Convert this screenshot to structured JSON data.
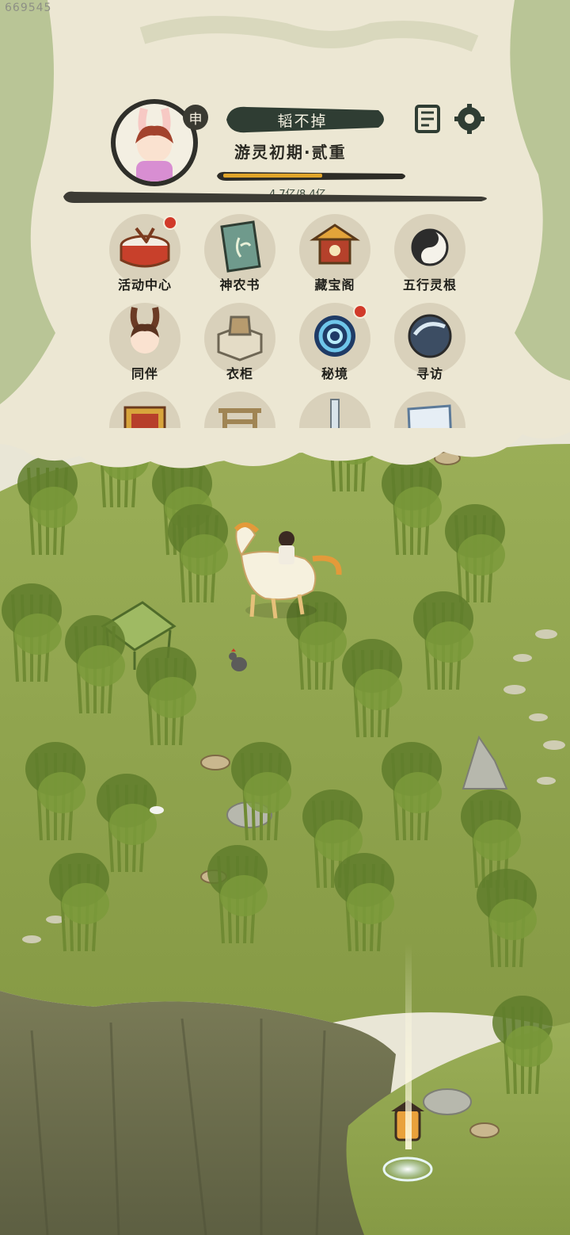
{
  "watermark": "669545",
  "player": {
    "name": "韬不掉",
    "zodiac_badge": "申",
    "realm": "游灵初期·贰重",
    "xp_text": "4.7亿/8.4亿",
    "xp_progress": 0.56
  },
  "top_icons": [
    "scroll-book-icon",
    "gear-icon"
  ],
  "menu": [
    {
      "label": "活动中心",
      "icon": "drum-icon",
      "badge": true
    },
    {
      "label": "神农书",
      "icon": "herb-book-icon",
      "badge": false
    },
    {
      "label": "藏宝阁",
      "icon": "pavilion-icon",
      "badge": false
    },
    {
      "label": "五行灵根",
      "icon": "yin-yang-icon",
      "badge": false
    },
    {
      "label": "同伴",
      "icon": "rabbit-companion-icon",
      "badge": false
    },
    {
      "label": "衣柜",
      "icon": "folded-robe-icon",
      "badge": false
    },
    {
      "label": "秘境",
      "icon": "portal-swirl-icon",
      "badge": true
    },
    {
      "label": "寻访",
      "icon": "crystal-orb-icon",
      "badge": false
    },
    {
      "label": "",
      "icon": "shrine-gate-icon",
      "badge": false
    },
    {
      "label": "",
      "icon": "archway-icon",
      "badge": false
    },
    {
      "label": "",
      "icon": "sword-icon",
      "badge": false
    },
    {
      "label": "",
      "icon": "scroll-map-icon",
      "badge": false
    }
  ],
  "colors": {
    "paper": "#ede8d6",
    "ink": "#2b2a23",
    "banner": "#2f3d33",
    "xp_fill": "#e0a52a",
    "grass": "#8ea24f",
    "bamboo": "#5f7d2c",
    "cliff": "#6b6d4c",
    "badge": "#d13a2a"
  }
}
